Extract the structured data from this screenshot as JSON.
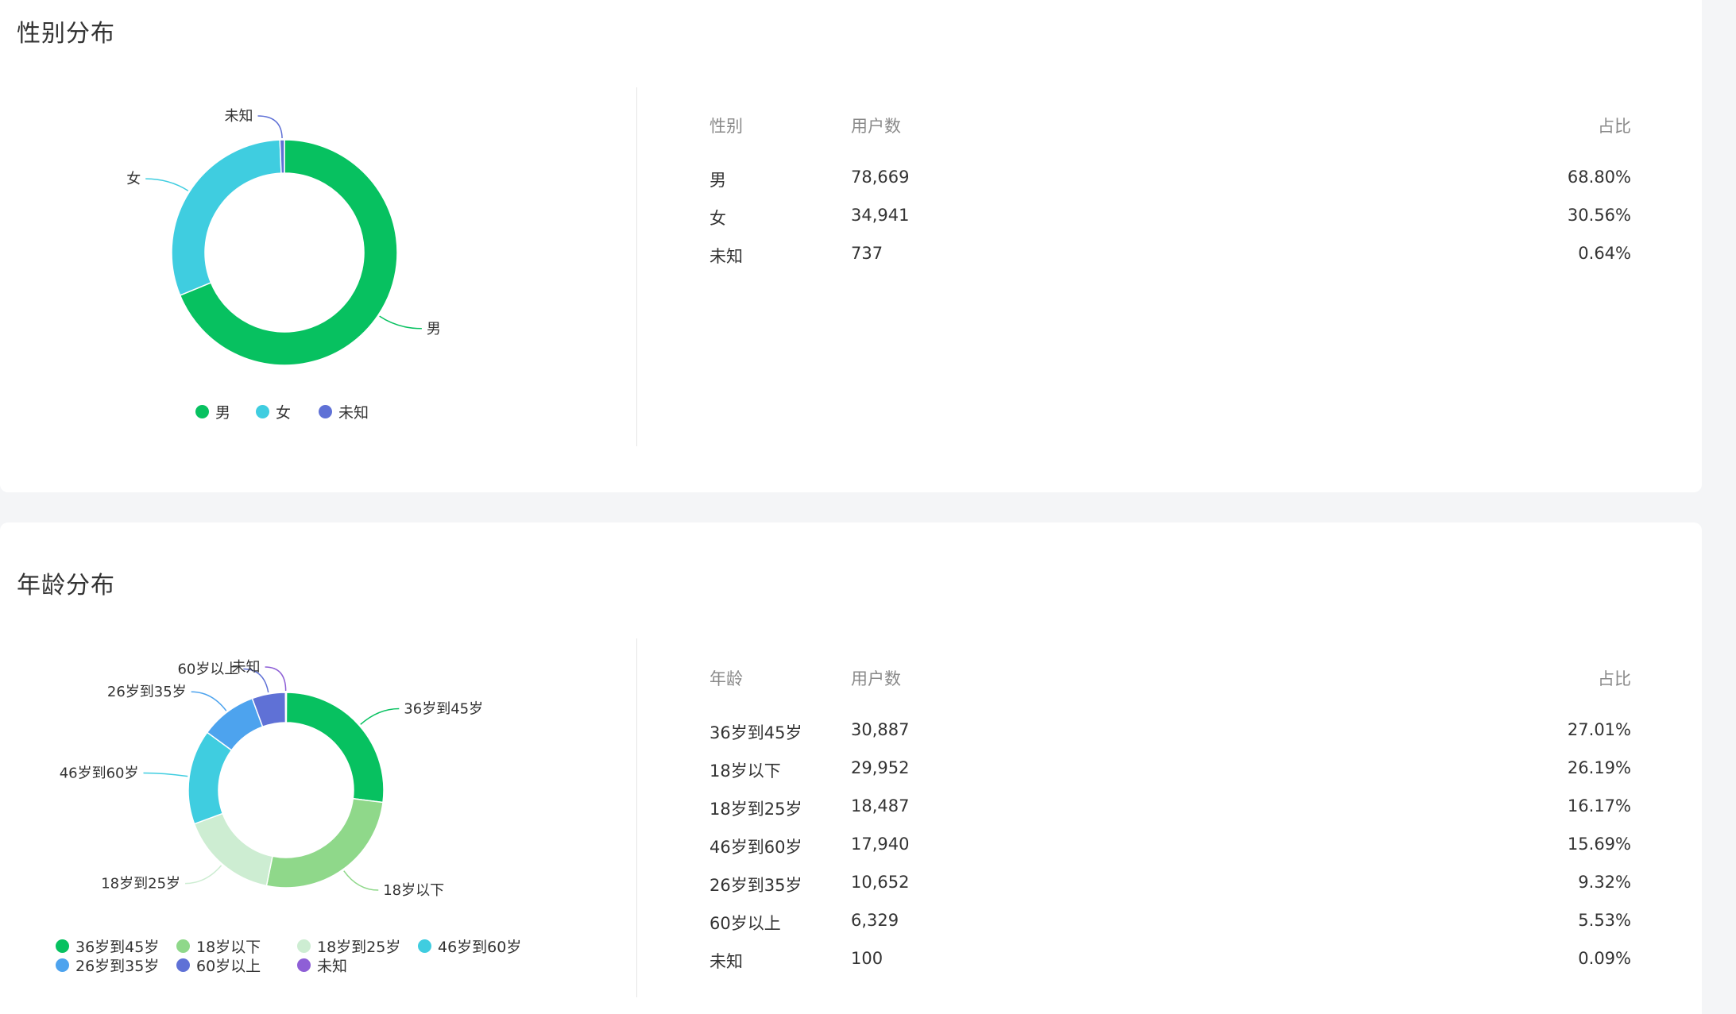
{
  "gender": {
    "title": "性别分布",
    "table": {
      "headers": [
        "性别",
        "用户数",
        "占比"
      ],
      "rows": [
        {
          "label": "男",
          "count": "78,669",
          "pct": "68.80%"
        },
        {
          "label": "女",
          "count": "34,941",
          "pct": "30.56%"
        },
        {
          "label": "未知",
          "count": "737",
          "pct": "0.64%"
        }
      ]
    }
  },
  "age": {
    "title": "年龄分布",
    "table": {
      "headers": [
        "年龄",
        "用户数",
        "占比"
      ],
      "rows": [
        {
          "label": "36岁到45岁",
          "count": "30,887",
          "pct": "27.01%"
        },
        {
          "label": "18岁以下",
          "count": "29,952",
          "pct": "26.19%"
        },
        {
          "label": "18岁到25岁",
          "count": "18,487",
          "pct": "16.17%"
        },
        {
          "label": "46岁到60岁",
          "count": "17,940",
          "pct": "15.69%"
        },
        {
          "label": "26岁到35岁",
          "count": "10,652",
          "pct": "9.32%"
        },
        {
          "label": "60岁以上",
          "count": "6,329",
          "pct": "5.53%"
        },
        {
          "label": "未知",
          "count": "100",
          "pct": "0.09%"
        }
      ]
    }
  },
  "chart_data": [
    {
      "type": "pie",
      "variant": "donut",
      "legend_position": "bottom",
      "categories": [
        "男",
        "女",
        "未知"
      ],
      "values": [
        78669,
        34941,
        737
      ],
      "colors": [
        "#07c160",
        "#3fcde0",
        "#5f71d6"
      ],
      "legend": [
        "男",
        "女",
        "未知"
      ]
    },
    {
      "type": "pie",
      "variant": "donut",
      "legend_position": "bottom",
      "categories": [
        "36岁到45岁",
        "18岁以下",
        "18岁到25岁",
        "46岁到60岁",
        "26岁到35岁",
        "60岁以上",
        "未知"
      ],
      "values": [
        30887,
        29952,
        18487,
        17940,
        10652,
        6329,
        100
      ],
      "colors": [
        "#07c160",
        "#8fd88a",
        "#cdedd2",
        "#3fcde0",
        "#4da3ee",
        "#5f71d6",
        "#8e5fd6"
      ],
      "legend": [
        "36岁到45岁",
        "18岁以下",
        "18岁到25岁",
        "46岁到60岁",
        "26岁到35岁",
        "60岁以上",
        "未知"
      ]
    }
  ]
}
